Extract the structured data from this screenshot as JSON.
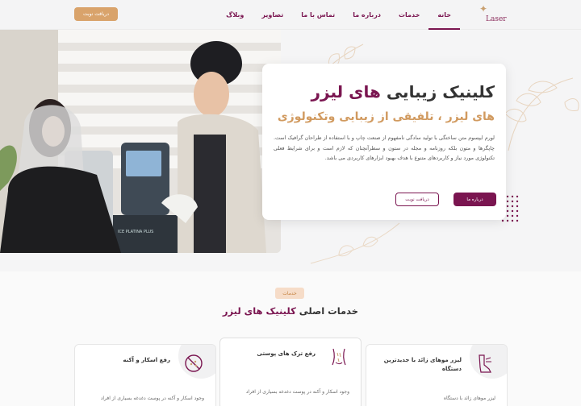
{
  "header": {
    "logo_text": "Laser",
    "nav": [
      "خانه",
      "خدمات",
      "درباره ما",
      "تماس با ما",
      "تصاویر",
      "وبلاگ"
    ],
    "cta_label": "دریافت نوبت"
  },
  "hero": {
    "title_main": "کلینیک زیبایی ",
    "title_accent": "های لیزر",
    "subtitle": "های لیزر ، تلفیقی از زیبایی وتکنولوژی",
    "body": "لورم ایپسوم متن ساختگی با تولید سادگی نامفهوم از صنعت چاپ و با استفاده از طراحان گرافیک است. چاپگرها و متون بلکه روزنامه و مجله در ستون و سطرآنچنان که لازم است و برای شرایط فعلی تکنولوژی مورد نیاز و کاربردهای متنوع با هدف بهبود ابزارهای کاربردی می باشد.",
    "primary_button": "درباره ما",
    "secondary_button": "دریافت نوبت",
    "photo_device_label": "ICE PLATINA PLUS"
  },
  "services": {
    "badge": "خدمات",
    "title_main": "خدمات اصلی ",
    "title_accent": "کلینیک های لیزر",
    "cards": [
      {
        "title": "لیزر موهای زائد با جدیدترین دستگاه",
        "icon": "laser-leg-icon",
        "text": "لیزر موهای زائد با دستگاه"
      },
      {
        "title": "رفع ترک های پوستی",
        "icon": "body-stretch-icon",
        "text": "وجود اسکار و آکنه در پوست دغدغه بسیاری از افراد"
      },
      {
        "title": "رفع اسکار و آکنه",
        "icon": "no-acne-icon",
        "text": "وجود اسکار و آکنه در پوست دغدغه بسیاری از افراد"
      }
    ]
  },
  "colors": {
    "brand": "#7a1550",
    "accent": "#d9a36b"
  }
}
